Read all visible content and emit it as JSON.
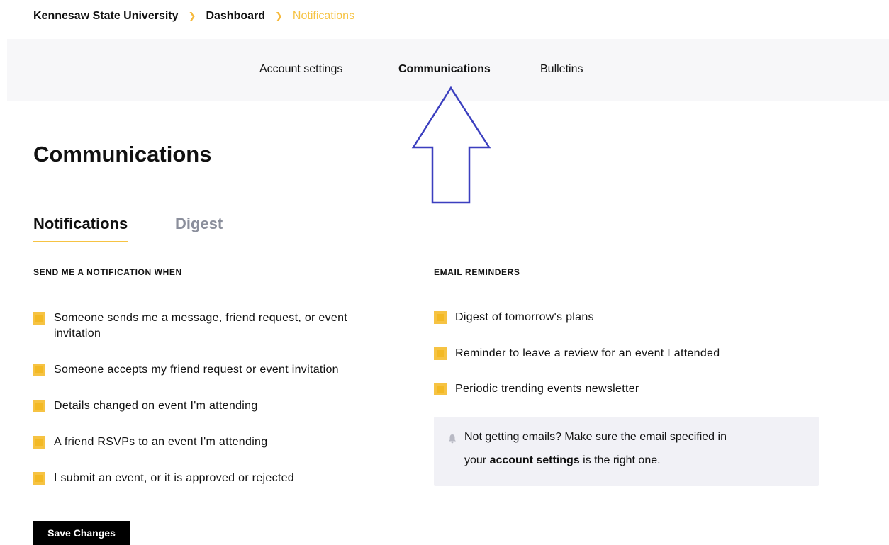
{
  "breadcrumb": {
    "items": [
      "Kennesaw State University",
      "Dashboard"
    ],
    "current": "Notifications"
  },
  "topnav": {
    "tabs": [
      {
        "label": "Account settings",
        "active": false
      },
      {
        "label": "Communications",
        "active": true
      },
      {
        "label": "Bulletins",
        "active": false
      }
    ]
  },
  "page": {
    "title": "Communications"
  },
  "subtabs": {
    "active": "Notifications",
    "inactive": "Digest"
  },
  "notifications": {
    "heading": "SEND ME A NOTIFICATION WHEN",
    "options": [
      {
        "line1": "Someone sends me a message, friend request, or event",
        "line2": "invitation",
        "checked": true
      },
      {
        "line1": "Someone accepts my friend request or event invitation",
        "checked": true
      },
      {
        "line1": "Details changed on event I'm attending",
        "checked": true
      },
      {
        "line1": "A friend RSVPs to an event I'm attending",
        "checked": true
      },
      {
        "line1": "I submit an event, or it is approved or rejected",
        "checked": true
      }
    ]
  },
  "reminders": {
    "heading": "EMAIL REMINDERS",
    "options": [
      {
        "label": "Digest of tomorrow's plans",
        "checked": true
      },
      {
        "label": "Reminder to leave a review for an event I attended",
        "checked": true
      },
      {
        "label": "Periodic trending events newsletter",
        "checked": true
      }
    ]
  },
  "info": {
    "icon": "bell-icon",
    "line1": "Not getting emails? Make sure the email specified in",
    "line2_prefix": "your ",
    "line2_link": "account settings",
    "line2_suffix": " is the right one."
  },
  "actions": {
    "save_label": "Save Changes"
  },
  "colors": {
    "accent": "#f6c343",
    "arrow": "#3b3fbf"
  }
}
